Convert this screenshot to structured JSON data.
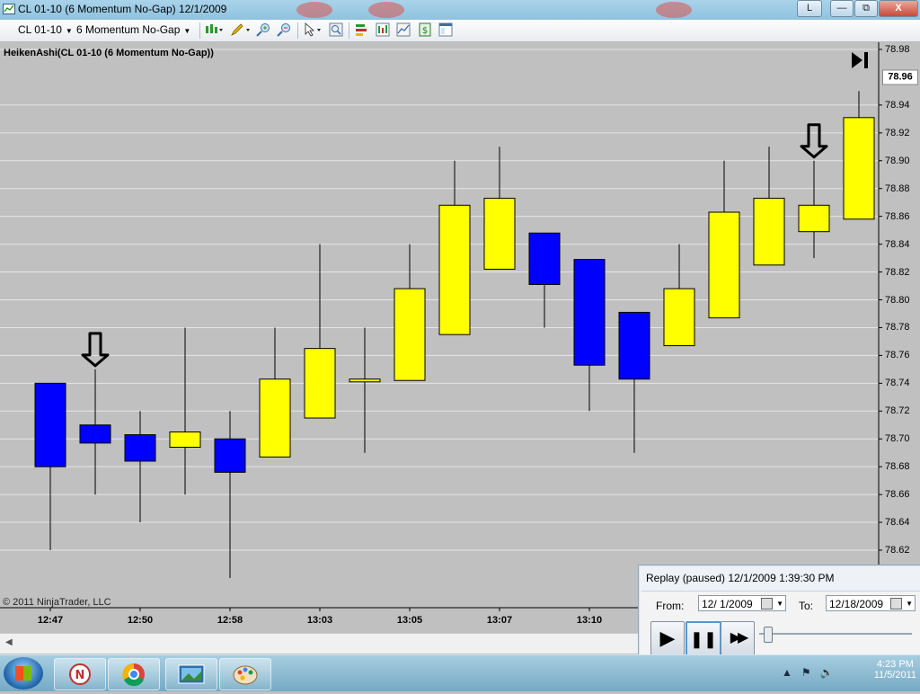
{
  "window": {
    "title": "CL 01-10 (6 Momentum No-Gap)  12/1/2009",
    "lang_button": "L",
    "minimize": "—",
    "restore": "⧉",
    "close": "X"
  },
  "toolbar": {
    "instrument": "CL 01-10",
    "period": "6 Momentum No-Gap",
    "icons": [
      "candlestick-style-icon",
      "drawing-pencil-icon",
      "zoom-in-icon",
      "zoom-out-icon",
      "cursor-icon",
      "magnify-icon",
      "strategy-icon",
      "indicator-icon",
      "data-box-icon",
      "order-entry-icon",
      "properties-icon"
    ]
  },
  "indicator_label": "HeikenAshi(CL 01-10 (6 Momentum No-Gap))",
  "copyright": "© 2011 NinjaTrader, LLC",
  "chart_data": {
    "type": "candlestick",
    "style": "Heiken Ashi",
    "colors": {
      "up": "#ffff00",
      "down": "#0000ff",
      "background": "#c0c0c0",
      "wick": "#000000",
      "grid": "#e6e6e6"
    },
    "ylim": [
      78.6,
      78.98
    ],
    "y_ticks": [
      "78.98",
      "78.94",
      "78.92",
      "78.90",
      "78.88",
      "78.86",
      "78.84",
      "78.82",
      "78.80",
      "78.78",
      "78.76",
      "78.74",
      "78.72",
      "78.70",
      "78.68",
      "78.66",
      "78.64",
      "78.62"
    ],
    "y_current": "78.96",
    "x_tick_labels": [
      "12:47",
      "12:50",
      "12:58",
      "13:03",
      "13:05",
      "13:07",
      "13:10"
    ],
    "candles": [
      {
        "dir": "down",
        "open": 78.74,
        "close": 78.68,
        "high": 78.74,
        "low": 78.62
      },
      {
        "dir": "down",
        "open": 78.71,
        "close": 78.697,
        "high": 78.75,
        "low": 78.66
      },
      {
        "dir": "down",
        "open": 78.703,
        "close": 78.684,
        "high": 78.72,
        "low": 78.64
      },
      {
        "dir": "up",
        "open": 78.694,
        "close": 78.705,
        "high": 78.78,
        "low": 78.66
      },
      {
        "dir": "down",
        "open": 78.7,
        "close": 78.676,
        "high": 78.72,
        "low": 78.6
      },
      {
        "dir": "up",
        "open": 78.687,
        "close": 78.743,
        "high": 78.78,
        "low": 78.687
      },
      {
        "dir": "up",
        "open": 78.715,
        "close": 78.765,
        "high": 78.84,
        "low": 78.715
      },
      {
        "dir": "up",
        "open": 78.741,
        "close": 78.743,
        "high": 78.78,
        "low": 78.69
      },
      {
        "dir": "up",
        "open": 78.742,
        "close": 78.808,
        "high": 78.84,
        "low": 78.742
      },
      {
        "dir": "up",
        "open": 78.775,
        "close": 78.868,
        "high": 78.9,
        "low": 78.775
      },
      {
        "dir": "up",
        "open": 78.822,
        "close": 78.873,
        "high": 78.91,
        "low": 78.822
      },
      {
        "dir": "down",
        "open": 78.848,
        "close": 78.811,
        "high": 78.848,
        "low": 78.78
      },
      {
        "dir": "down",
        "open": 78.829,
        "close": 78.753,
        "high": 78.829,
        "low": 78.72
      },
      {
        "dir": "down",
        "open": 78.791,
        "close": 78.743,
        "high": 78.791,
        "low": 78.69
      },
      {
        "dir": "up",
        "open": 78.767,
        "close": 78.808,
        "high": 78.84,
        "low": 78.767
      },
      {
        "dir": "up",
        "open": 78.787,
        "close": 78.863,
        "high": 78.9,
        "low": 78.787
      },
      {
        "dir": "up",
        "open": 78.825,
        "close": 78.873,
        "high": 78.91,
        "low": 78.825
      },
      {
        "dir": "up",
        "open": 78.849,
        "close": 78.868,
        "high": 78.9,
        "low": 78.83
      },
      {
        "dir": "up",
        "open": 78.858,
        "close": 78.931,
        "high": 78.95,
        "low": 78.858
      }
    ],
    "arrows_over_candles": [
      1,
      17
    ]
  },
  "replay": {
    "title": "Replay (paused) 12/1/2009 1:39:30 PM",
    "from_label": "From:",
    "from_value": "12/  1/2009",
    "to_label": "To:",
    "to_value": "12/18/2009",
    "play_label": "▶",
    "pause_label": "❚❚",
    "fast_label": "▶▶"
  },
  "taskbar": {
    "time": "4:23 PM",
    "date": "11/5/2011",
    "apps": [
      "ninjatrader-icon",
      "chrome-icon",
      "slideshow-icon",
      "paint-icon"
    ]
  }
}
